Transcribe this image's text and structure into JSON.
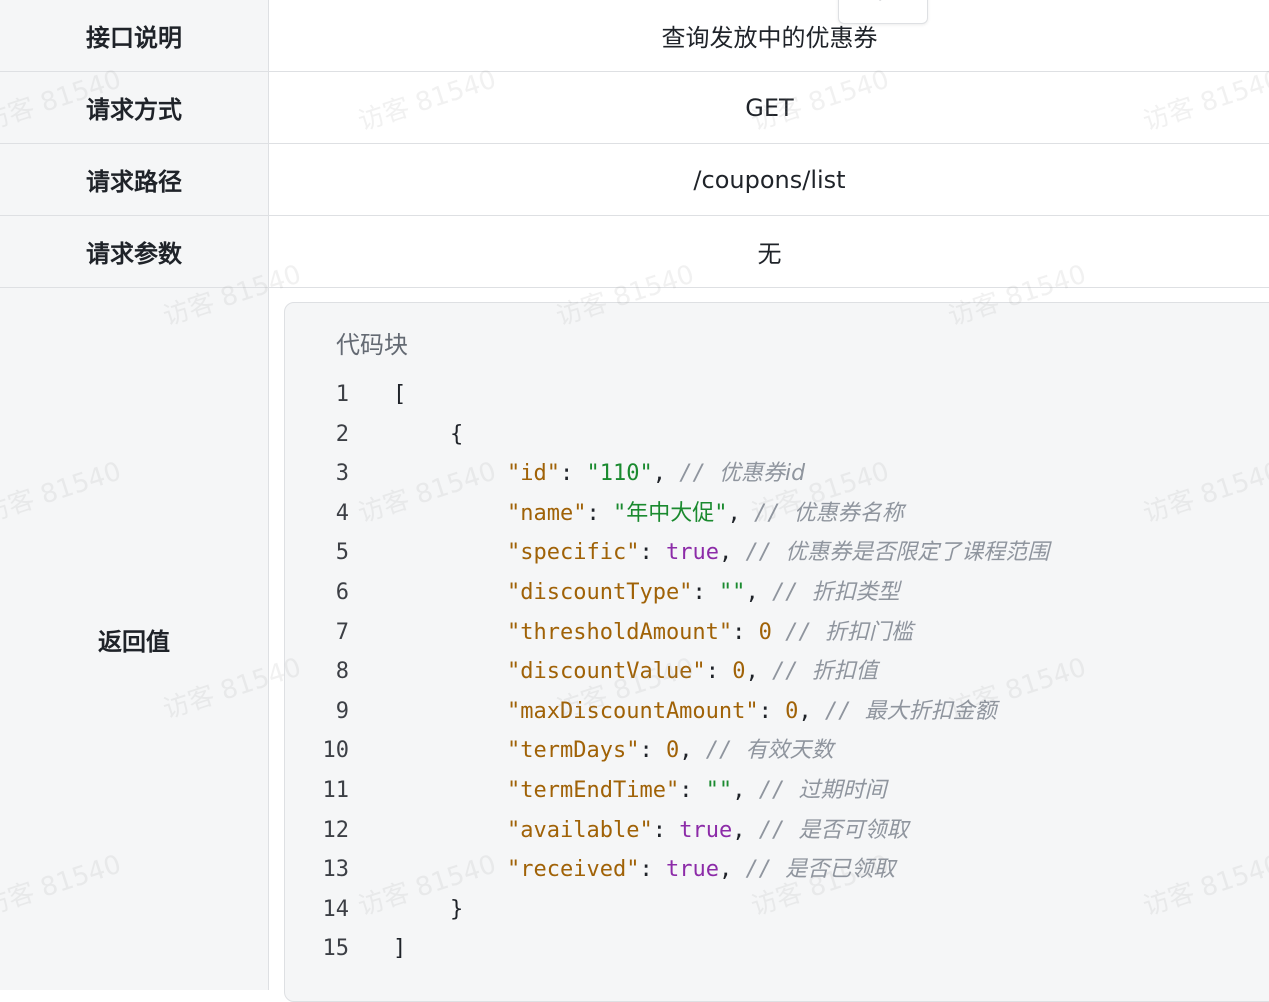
{
  "table": {
    "rows": [
      {
        "key": "接口说明",
        "value": "查询发放中的优惠券"
      },
      {
        "key": "请求方式",
        "value": "GET"
      },
      {
        "key": "请求路径",
        "value": "/coupons/list"
      },
      {
        "key": "请求参数",
        "value": "无"
      },
      {
        "key": "返回值"
      }
    ]
  },
  "tab_stub_label": "⟲",
  "code_block": {
    "title": "代码块",
    "lines": [
      {
        "n": "1",
        "indent": 0,
        "parts": [
          {
            "t": "plain",
            "v": "["
          }
        ]
      },
      {
        "n": "2",
        "indent": 1,
        "parts": [
          {
            "t": "plain",
            "v": "{"
          }
        ]
      },
      {
        "n": "3",
        "indent": 2,
        "parts": [
          {
            "t": "key",
            "v": "\"id\""
          },
          {
            "t": "plain",
            "v": ": "
          },
          {
            "t": "str",
            "v": "\"110\""
          },
          {
            "t": "plain",
            "v": ", "
          },
          {
            "t": "com",
            "v": "优惠券id"
          }
        ]
      },
      {
        "n": "4",
        "indent": 2,
        "parts": [
          {
            "t": "key",
            "v": "\"name\""
          },
          {
            "t": "plain",
            "v": ": "
          },
          {
            "t": "str",
            "v": "\"年中大促\""
          },
          {
            "t": "plain",
            "v": ", "
          },
          {
            "t": "com",
            "v": "优惠券名称"
          }
        ]
      },
      {
        "n": "5",
        "indent": 2,
        "parts": [
          {
            "t": "key",
            "v": "\"specific\""
          },
          {
            "t": "plain",
            "v": ": "
          },
          {
            "t": "bool",
            "v": "true"
          },
          {
            "t": "plain",
            "v": ", "
          },
          {
            "t": "com",
            "v": "优惠券是否限定了课程范围"
          }
        ]
      },
      {
        "n": "6",
        "indent": 2,
        "parts": [
          {
            "t": "key",
            "v": "\"discountType\""
          },
          {
            "t": "plain",
            "v": ": "
          },
          {
            "t": "str",
            "v": "\"\""
          },
          {
            "t": "plain",
            "v": ", "
          },
          {
            "t": "com",
            "v": "折扣类型"
          }
        ]
      },
      {
        "n": "7",
        "indent": 2,
        "parts": [
          {
            "t": "key",
            "v": "\"thresholdAmount\""
          },
          {
            "t": "plain",
            "v": ": "
          },
          {
            "t": "num",
            "v": "0"
          },
          {
            "t": "plain",
            "v": " "
          },
          {
            "t": "com",
            "v": "折扣门槛"
          }
        ]
      },
      {
        "n": "8",
        "indent": 2,
        "parts": [
          {
            "t": "key",
            "v": "\"discountValue\""
          },
          {
            "t": "plain",
            "v": ": "
          },
          {
            "t": "num",
            "v": "0"
          },
          {
            "t": "plain",
            "v": ", "
          },
          {
            "t": "com",
            "v": "折扣值"
          }
        ]
      },
      {
        "n": "9",
        "indent": 2,
        "parts": [
          {
            "t": "key",
            "v": "\"maxDiscountAmount\""
          },
          {
            "t": "plain",
            "v": ": "
          },
          {
            "t": "num",
            "v": "0"
          },
          {
            "t": "plain",
            "v": ", "
          },
          {
            "t": "com",
            "v": "最大折扣金额"
          }
        ]
      },
      {
        "n": "10",
        "indent": 2,
        "parts": [
          {
            "t": "key",
            "v": "\"termDays\""
          },
          {
            "t": "plain",
            "v": ": "
          },
          {
            "t": "num",
            "v": "0"
          },
          {
            "t": "plain",
            "v": ", "
          },
          {
            "t": "com",
            "v": "有效天数"
          }
        ]
      },
      {
        "n": "11",
        "indent": 2,
        "parts": [
          {
            "t": "key",
            "v": "\"termEndTime\""
          },
          {
            "t": "plain",
            "v": ": "
          },
          {
            "t": "str",
            "v": "\"\""
          },
          {
            "t": "plain",
            "v": ", "
          },
          {
            "t": "com",
            "v": "过期时间"
          }
        ]
      },
      {
        "n": "12",
        "indent": 2,
        "parts": [
          {
            "t": "key",
            "v": "\"available\""
          },
          {
            "t": "plain",
            "v": ": "
          },
          {
            "t": "bool",
            "v": "true"
          },
          {
            "t": "plain",
            "v": ", "
          },
          {
            "t": "com",
            "v": "是否可领取"
          }
        ]
      },
      {
        "n": "13",
        "indent": 2,
        "parts": [
          {
            "t": "key",
            "v": "\"received\""
          },
          {
            "t": "plain",
            "v": ": "
          },
          {
            "t": "bool",
            "v": "true"
          },
          {
            "t": "plain",
            "v": ", "
          },
          {
            "t": "com",
            "v": "是否已领取"
          }
        ]
      },
      {
        "n": "14",
        "indent": 1,
        "parts": [
          {
            "t": "plain",
            "v": "}"
          }
        ]
      },
      {
        "n": "15",
        "indent": 0,
        "parts": [
          {
            "t": "plain",
            "v": "]"
          }
        ]
      }
    ]
  },
  "watermark": "访客 81540"
}
